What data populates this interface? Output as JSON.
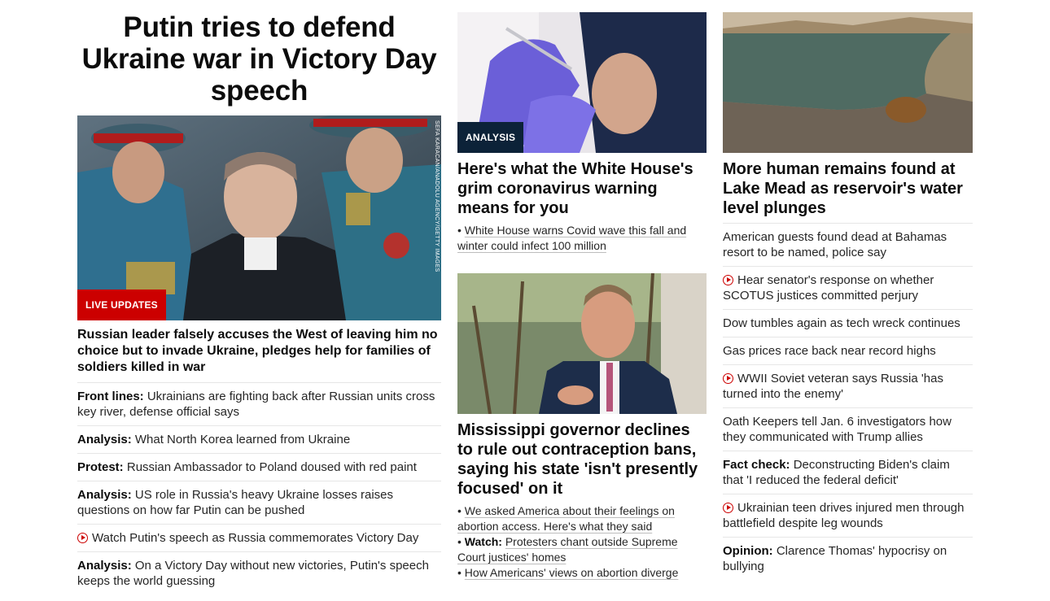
{
  "col1": {
    "headline": "Putin tries to defend Ukraine war in Victory Day speech",
    "photo_credit": "SEFA KARACAN/ANADOLU AGENCY/GETTY IMAGES",
    "label": "LIVE UPDATES",
    "subhead": "Russian leader falsely accuses the West of leaving him no choice but to invade Ukraine, pledges help for families of soldiers killed in war",
    "items": [
      {
        "prefix": "Front lines:",
        "text": "Ukrainians are fighting back after Russian units cross key river, defense official says"
      },
      {
        "prefix": "Analysis:",
        "text": "What North Korea learned from Ukraine"
      },
      {
        "prefix": "Protest:",
        "text": "Russian Ambassador to Poland doused with red paint"
      },
      {
        "prefix": "Analysis:",
        "text": "US role in Russia's heavy Ukraine losses raises questions on how far Putin can be pushed"
      },
      {
        "video": true,
        "text": "Watch Putin's speech as Russia commemorates Victory Day"
      },
      {
        "prefix": "Analysis:",
        "text": "On a Victory Day without new victories, Putin's speech keeps the world guessing"
      }
    ]
  },
  "col2": {
    "story1": {
      "label": "ANALYSIS",
      "headline": "Here's what the White House's grim coronavirus warning means for you",
      "bullets": [
        "White House warns Covid wave this fall and winter could infect 100 million"
      ]
    },
    "story2": {
      "headline": "Mississippi governor declines to rule out contraception bans, saying his state 'isn't presently focused' on it",
      "bullet1": "We asked America about their feelings on abortion access. Here's what they said",
      "bullet2_prefix": "Watch:",
      "bullet2": "Protesters chant outside Supreme Court justices' homes",
      "bullet3": "How Americans' views on abortion diverge"
    }
  },
  "col3": {
    "headline": "More human remains found at Lake Mead as reservoir's water level plunges",
    "items": [
      {
        "text": "American guests found dead at Bahamas resort to be named, police say"
      },
      {
        "video": true,
        "text": "Hear senator's response on whether SCOTUS justices committed perjury"
      },
      {
        "text": "Dow tumbles again as tech wreck continues"
      },
      {
        "text": "Gas prices race back near record highs"
      },
      {
        "video": true,
        "text": "WWII Soviet veteran says Russia 'has turned into the enemy'"
      },
      {
        "text": "Oath Keepers tell Jan. 6 investigators how they communicated with Trump allies"
      },
      {
        "prefix": "Fact check:",
        "text": "Deconstructing Biden's claim that 'I reduced the federal deficit'"
      },
      {
        "video": true,
        "text": "Ukrainian teen drives injured men through battlefield despite leg wounds"
      },
      {
        "prefix": "Opinion:",
        "text": "Clarence Thomas' hypocrisy on bullying"
      }
    ]
  },
  "colors": {
    "live": "#cc0000",
    "analysis": "#0c2238"
  }
}
